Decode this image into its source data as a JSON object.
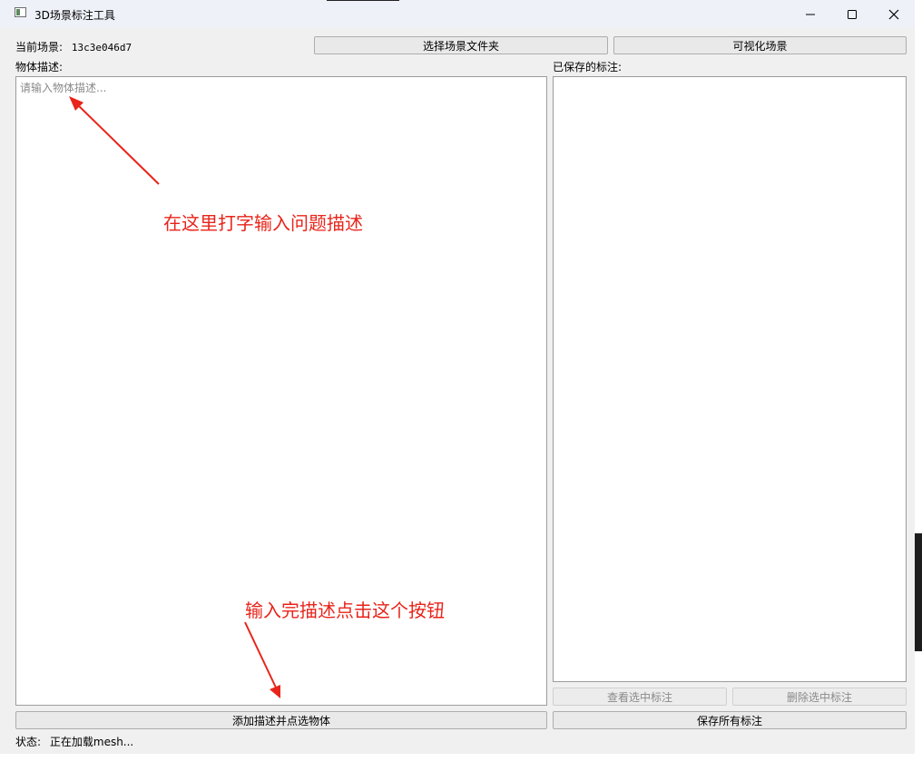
{
  "window": {
    "title": "3D场景标注工具",
    "icons": {
      "app": "app-window-icon",
      "minimize": "minimize-icon",
      "maximize": "maximize-icon",
      "close": "close-icon"
    }
  },
  "scene": {
    "label": "当前场景:",
    "id": "13c3e046d7",
    "select_folder_button": "选择场景文件夹",
    "visualize_button": "可视化场景"
  },
  "description": {
    "label": "物体描述:",
    "placeholder": "请输入物体描述...",
    "value": "",
    "add_button": "添加描述并点选物体"
  },
  "saved": {
    "label": "已保存的标注:",
    "items": [],
    "view_selected_button": "查看选中标注",
    "delete_selected_button": "删除选中标注",
    "save_all_button": "保存所有标注"
  },
  "status": {
    "label": "状态:",
    "text": "正在加载mesh..."
  },
  "annotations": {
    "note_top": "在这里打字输入问题描述",
    "note_bottom": "输入完描述点击这个按钮",
    "arrow_color": "#e8241a"
  }
}
